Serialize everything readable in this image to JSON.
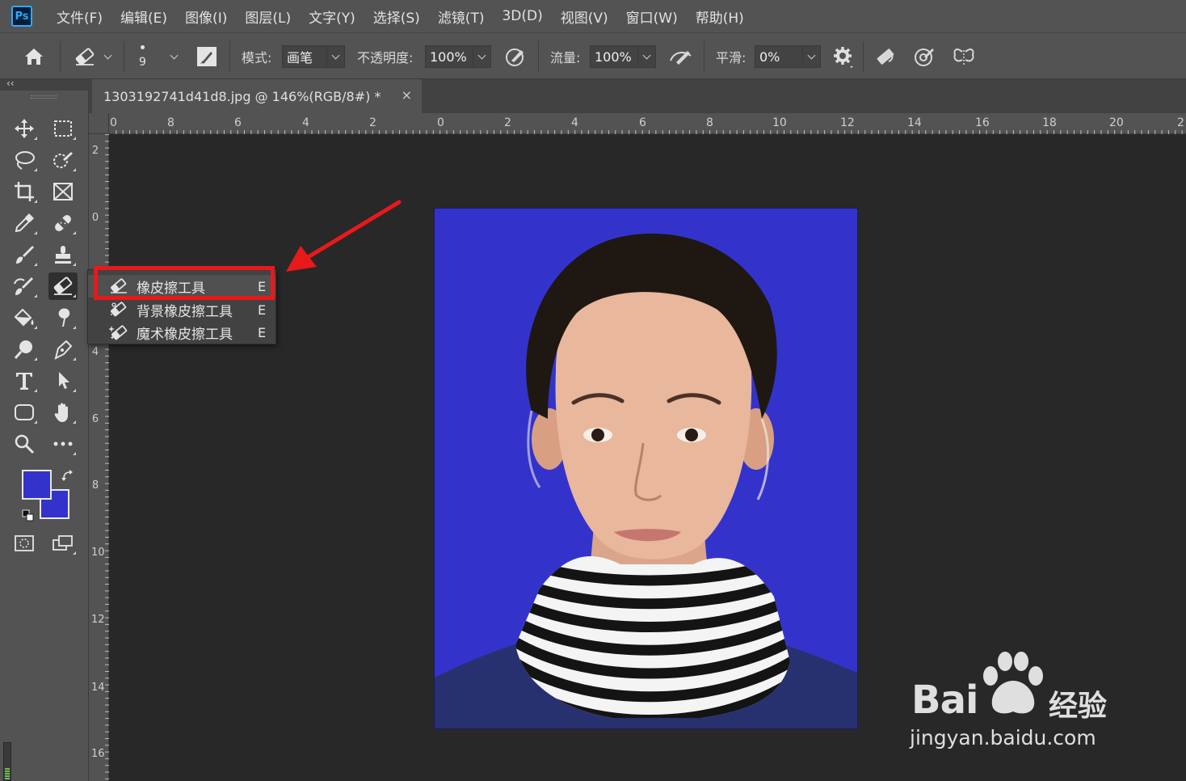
{
  "app": {
    "logo_text": "Ps"
  },
  "menubar": {
    "items": [
      "文件(F)",
      "编辑(E)",
      "图像(I)",
      "图层(L)",
      "文字(Y)",
      "选择(S)",
      "滤镜(T)",
      "3D(D)",
      "视图(V)",
      "窗口(W)",
      "帮助(H)"
    ]
  },
  "options": {
    "brush_size": "9",
    "mode_label": "模式:",
    "mode_value": "画笔",
    "opacity_label": "不透明度:",
    "opacity_value": "100%",
    "flow_label": "流量:",
    "flow_value": "100%",
    "smoothing_label": "平滑:",
    "smoothing_value": "0%"
  },
  "document": {
    "tab_title": "1303192741d41d8.jpg @ 146%(RGB/8#) *",
    "close_glyph": "×"
  },
  "rulers": {
    "top_labels": [
      "0",
      "8",
      "6",
      "4",
      "2",
      "0",
      "2",
      "4",
      "6",
      "8",
      "10",
      "12",
      "14",
      "16",
      "18",
      "20",
      "2"
    ],
    "left_labels": [
      "2",
      "0",
      "4",
      "6",
      "8",
      "10",
      "12",
      "14",
      "16"
    ]
  },
  "colors": {
    "foreground": "#3333cc",
    "background": "#3333cc",
    "photo_background": "#3333cc",
    "highlight": "#e8191b",
    "ui_panel": "#535353",
    "canvas": "#282828"
  },
  "flyout": {
    "items": [
      {
        "label": "橡皮擦工具",
        "shortcut": "E",
        "icon": "eraser-icon",
        "selected": true
      },
      {
        "label": "背景橡皮擦工具",
        "shortcut": "E",
        "icon": "background-eraser-icon",
        "selected": false
      },
      {
        "label": "魔术橡皮擦工具",
        "shortcut": "E",
        "icon": "magic-eraser-icon",
        "selected": false
      }
    ]
  },
  "watermark": {
    "brand": "Bai",
    "suffix": "经验",
    "url": "jingyan.baidu.com"
  }
}
